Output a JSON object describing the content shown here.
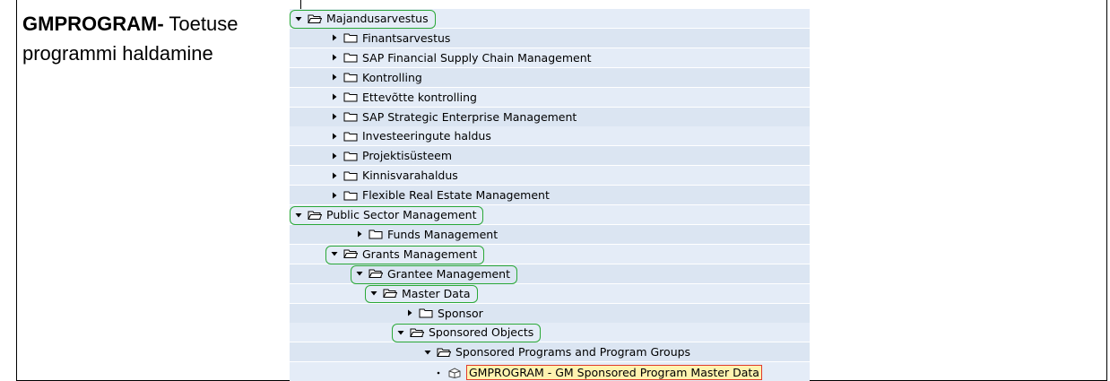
{
  "left": {
    "title_bold": "GMPROGRAM-",
    "title_rest": " Toetuse programmi haldamine"
  },
  "tree": [
    {
      "label": "Majandusarvestus",
      "level": 0,
      "open": true
    },
    {
      "label": "Finantsarvestus",
      "level": 1,
      "open": false
    },
    {
      "label": "SAP Financial Supply Chain Management",
      "level": 1,
      "open": false
    },
    {
      "label": "Kontrolling",
      "level": 1,
      "open": false
    },
    {
      "label": "Ettevõtte kontrolling",
      "level": 1,
      "open": false
    },
    {
      "label": "SAP Strategic Enterprise Management",
      "level": 1,
      "open": false
    },
    {
      "label": "Investeeringute haldus",
      "level": 1,
      "open": false
    },
    {
      "label": "Projektisüsteem",
      "level": 1,
      "open": false
    },
    {
      "label": "Kinnisvarahaldus",
      "level": 1,
      "open": false
    },
    {
      "label": "Flexible Real Estate Management",
      "level": 1,
      "open": false
    },
    {
      "label": "Public Sector Management",
      "level": 0,
      "open": true
    },
    {
      "label": "Funds Management",
      "level": 2,
      "open": false
    },
    {
      "label": "Grants Management",
      "level": 1,
      "open": true
    },
    {
      "label": "Grantee Management",
      "level": 2,
      "open": true
    },
    {
      "label": "Master Data",
      "level": 3,
      "open": true
    },
    {
      "label": "Sponsor",
      "level": 4,
      "open": false
    },
    {
      "label": "Sponsored Objects",
      "level": 4,
      "open": true
    },
    {
      "label": "Sponsored Programs and Program Groups",
      "level": 5,
      "open": true
    },
    {
      "label": "GMPROGRAM - GM Sponsored Program Master Data",
      "level": 6,
      "leaf": true
    }
  ],
  "colors": {
    "highlight_oval": "#2aa838",
    "selected_border": "#e03a2c"
  }
}
